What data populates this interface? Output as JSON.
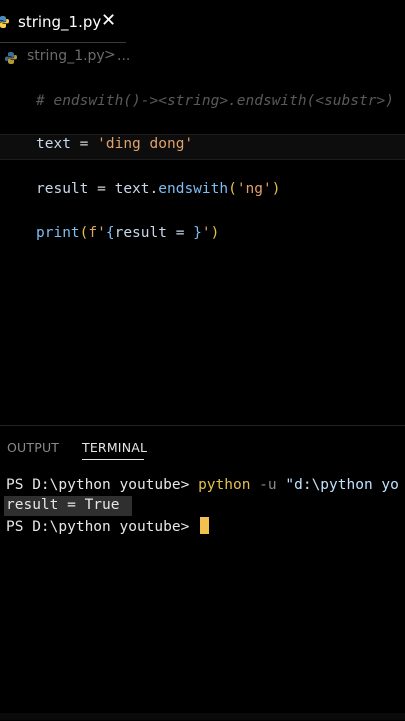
{
  "tab": {
    "label": "string_1.py",
    "icon": "python-icon",
    "close_glyph": "✕"
  },
  "breadcrumb": {
    "file": "string_1.py",
    "separator": ">",
    "more": "..."
  },
  "editor": {
    "comment": "# endswith()-><string>.endswith(<substr>)",
    "line_text": {
      "var": "text",
      "op": " = ",
      "str": "'ding dong'"
    },
    "line_result": {
      "var": "result",
      "op": " = ",
      "obj": "text",
      "dot": ".",
      "method": "endswith",
      "open": "(",
      "str": "'ng'",
      "close": ")"
    },
    "line_print": {
      "fn": "print",
      "open": "(",
      "fprefix": "f'",
      "lbrace": "{",
      "expr": "result = ",
      "rbrace": "}",
      "fend": "'",
      "close": ")"
    }
  },
  "panel": {
    "tab_output": "OUTPUT",
    "tab_terminal": "TERMINAL"
  },
  "terminal": {
    "prompt": "PS D:\\python youtube> ",
    "command": "python",
    "flag": " -u ",
    "arg": "\"d:\\python yo",
    "result_line": "result = True",
    "prompt2": "PS D:\\python youtube> "
  },
  "colors": {
    "background": "#000000",
    "string": "#e0a06a",
    "function": "#7fbcf2",
    "command": "#e3c14d",
    "cursor": "#f2c14e"
  }
}
